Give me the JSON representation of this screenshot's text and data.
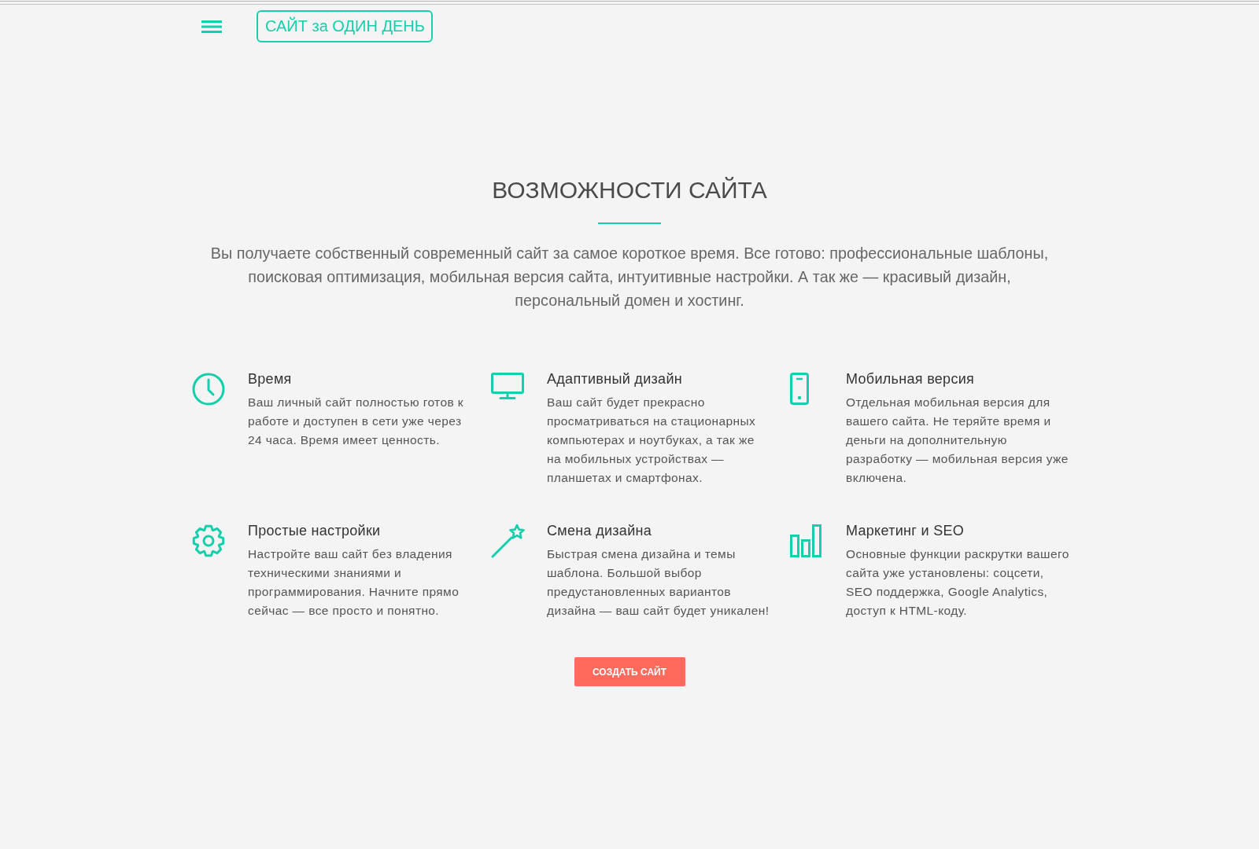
{
  "header": {
    "logo": "САЙТ за ОДИН ДЕНЬ"
  },
  "features_section": {
    "title": "ВОЗМОЖНОСТИ САЙТА",
    "intro": "Вы получаете собственный современный сайт за самое короткое время. Все готово: профессиональные шаблоны, поисковая оптимизация, мобильная версия сайта, интуитивные настройки. А так же — красивый дизайн, персональный домен и хостинг.",
    "features": [
      {
        "title": "Время",
        "text": "Ваш личный сайт полностью готов к работе и доступен в сети уже через 24 часа. Время имеет ценность."
      },
      {
        "title": "Адаптивный дизайн",
        "text": "Ваш сайт будет прекрасно просматриваться на стационарных компьютерах и ноутбуках, а так же на мобильных устройствах — планшетах и смартфонах."
      },
      {
        "title": "Мобильная версия",
        "text": "Отдельная мобильная версия для вашего сайта. Не теряйте время и деньги на дополнительную разработку — мобильная версия уже включена."
      },
      {
        "title": "Простые настройки",
        "text": "Настройте ваш сайт без владения техническими знаниями и программирования. Начните прямо сейчас — все просто и понятно."
      },
      {
        "title": "Смена дизайна",
        "text": "Быстрая смена дизайна и темы шаблона. Большой выбор предустановленных вариантов дизайна — ваш сайт будет уникален!"
      },
      {
        "title": "Маркетинг и SEO",
        "text": "Основные функции раскрутки вашего сайта уже установлены: соцсети, SEO поддержка, Google Analytics, доступ к HTML-коду."
      }
    ],
    "button": "СОЗДАТЬ САЙТ"
  }
}
